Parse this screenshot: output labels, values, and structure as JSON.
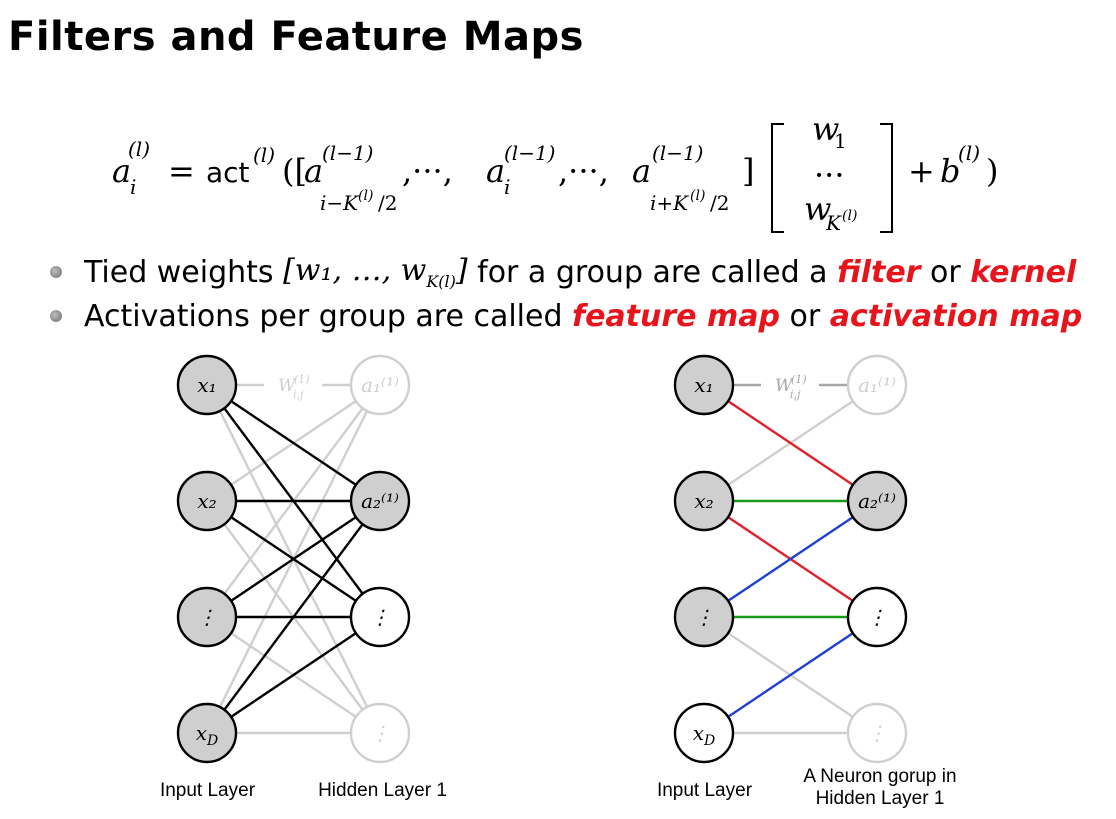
{
  "slide": {
    "title": "Filters and Feature Maps"
  },
  "bullets": [
    {
      "pre": "Tied weights ",
      "math": "[w₁, …, w",
      "math_sub": "K(l)",
      "math_end": "]",
      "mid": " for a group are called a ",
      "e1": "filter",
      "or": " or ",
      "e2": "kernel"
    },
    {
      "pre": "Activations per group are called ",
      "e1": "feature map",
      "or": " or ",
      "e2": "activation map"
    }
  ],
  "diagram_left": {
    "input_nodes": [
      "x₁",
      "x₂",
      "⋮",
      "x_D"
    ],
    "hidden_nodes": [
      "a₁⁽¹⁾",
      "a₂⁽¹⁾",
      "⋮",
      "⋮"
    ],
    "weight_label": "W",
    "input_caption": "Input Layer",
    "hidden_caption": "Hidden Layer 1"
  },
  "diagram_right": {
    "input_nodes": [
      "x₁",
      "x₂",
      "⋮",
      "x_D"
    ],
    "hidden_nodes": [
      "a₁⁽¹⁾",
      "a₂⁽¹⁾",
      "⋮",
      "⋮"
    ],
    "weight_label": "W",
    "input_caption": "Input Layer",
    "hidden_caption_line1": "A Neuron gorup in",
    "hidden_caption_line2": "Hidden Layer 1"
  },
  "colors": {
    "emphasis": "#e8141c",
    "edge_red": "#e0202a",
    "edge_green": "#1a9a1a",
    "edge_blue": "#1f3fd6",
    "faded": "#cfcfcf",
    "node_fill": "#cfcfcf"
  }
}
